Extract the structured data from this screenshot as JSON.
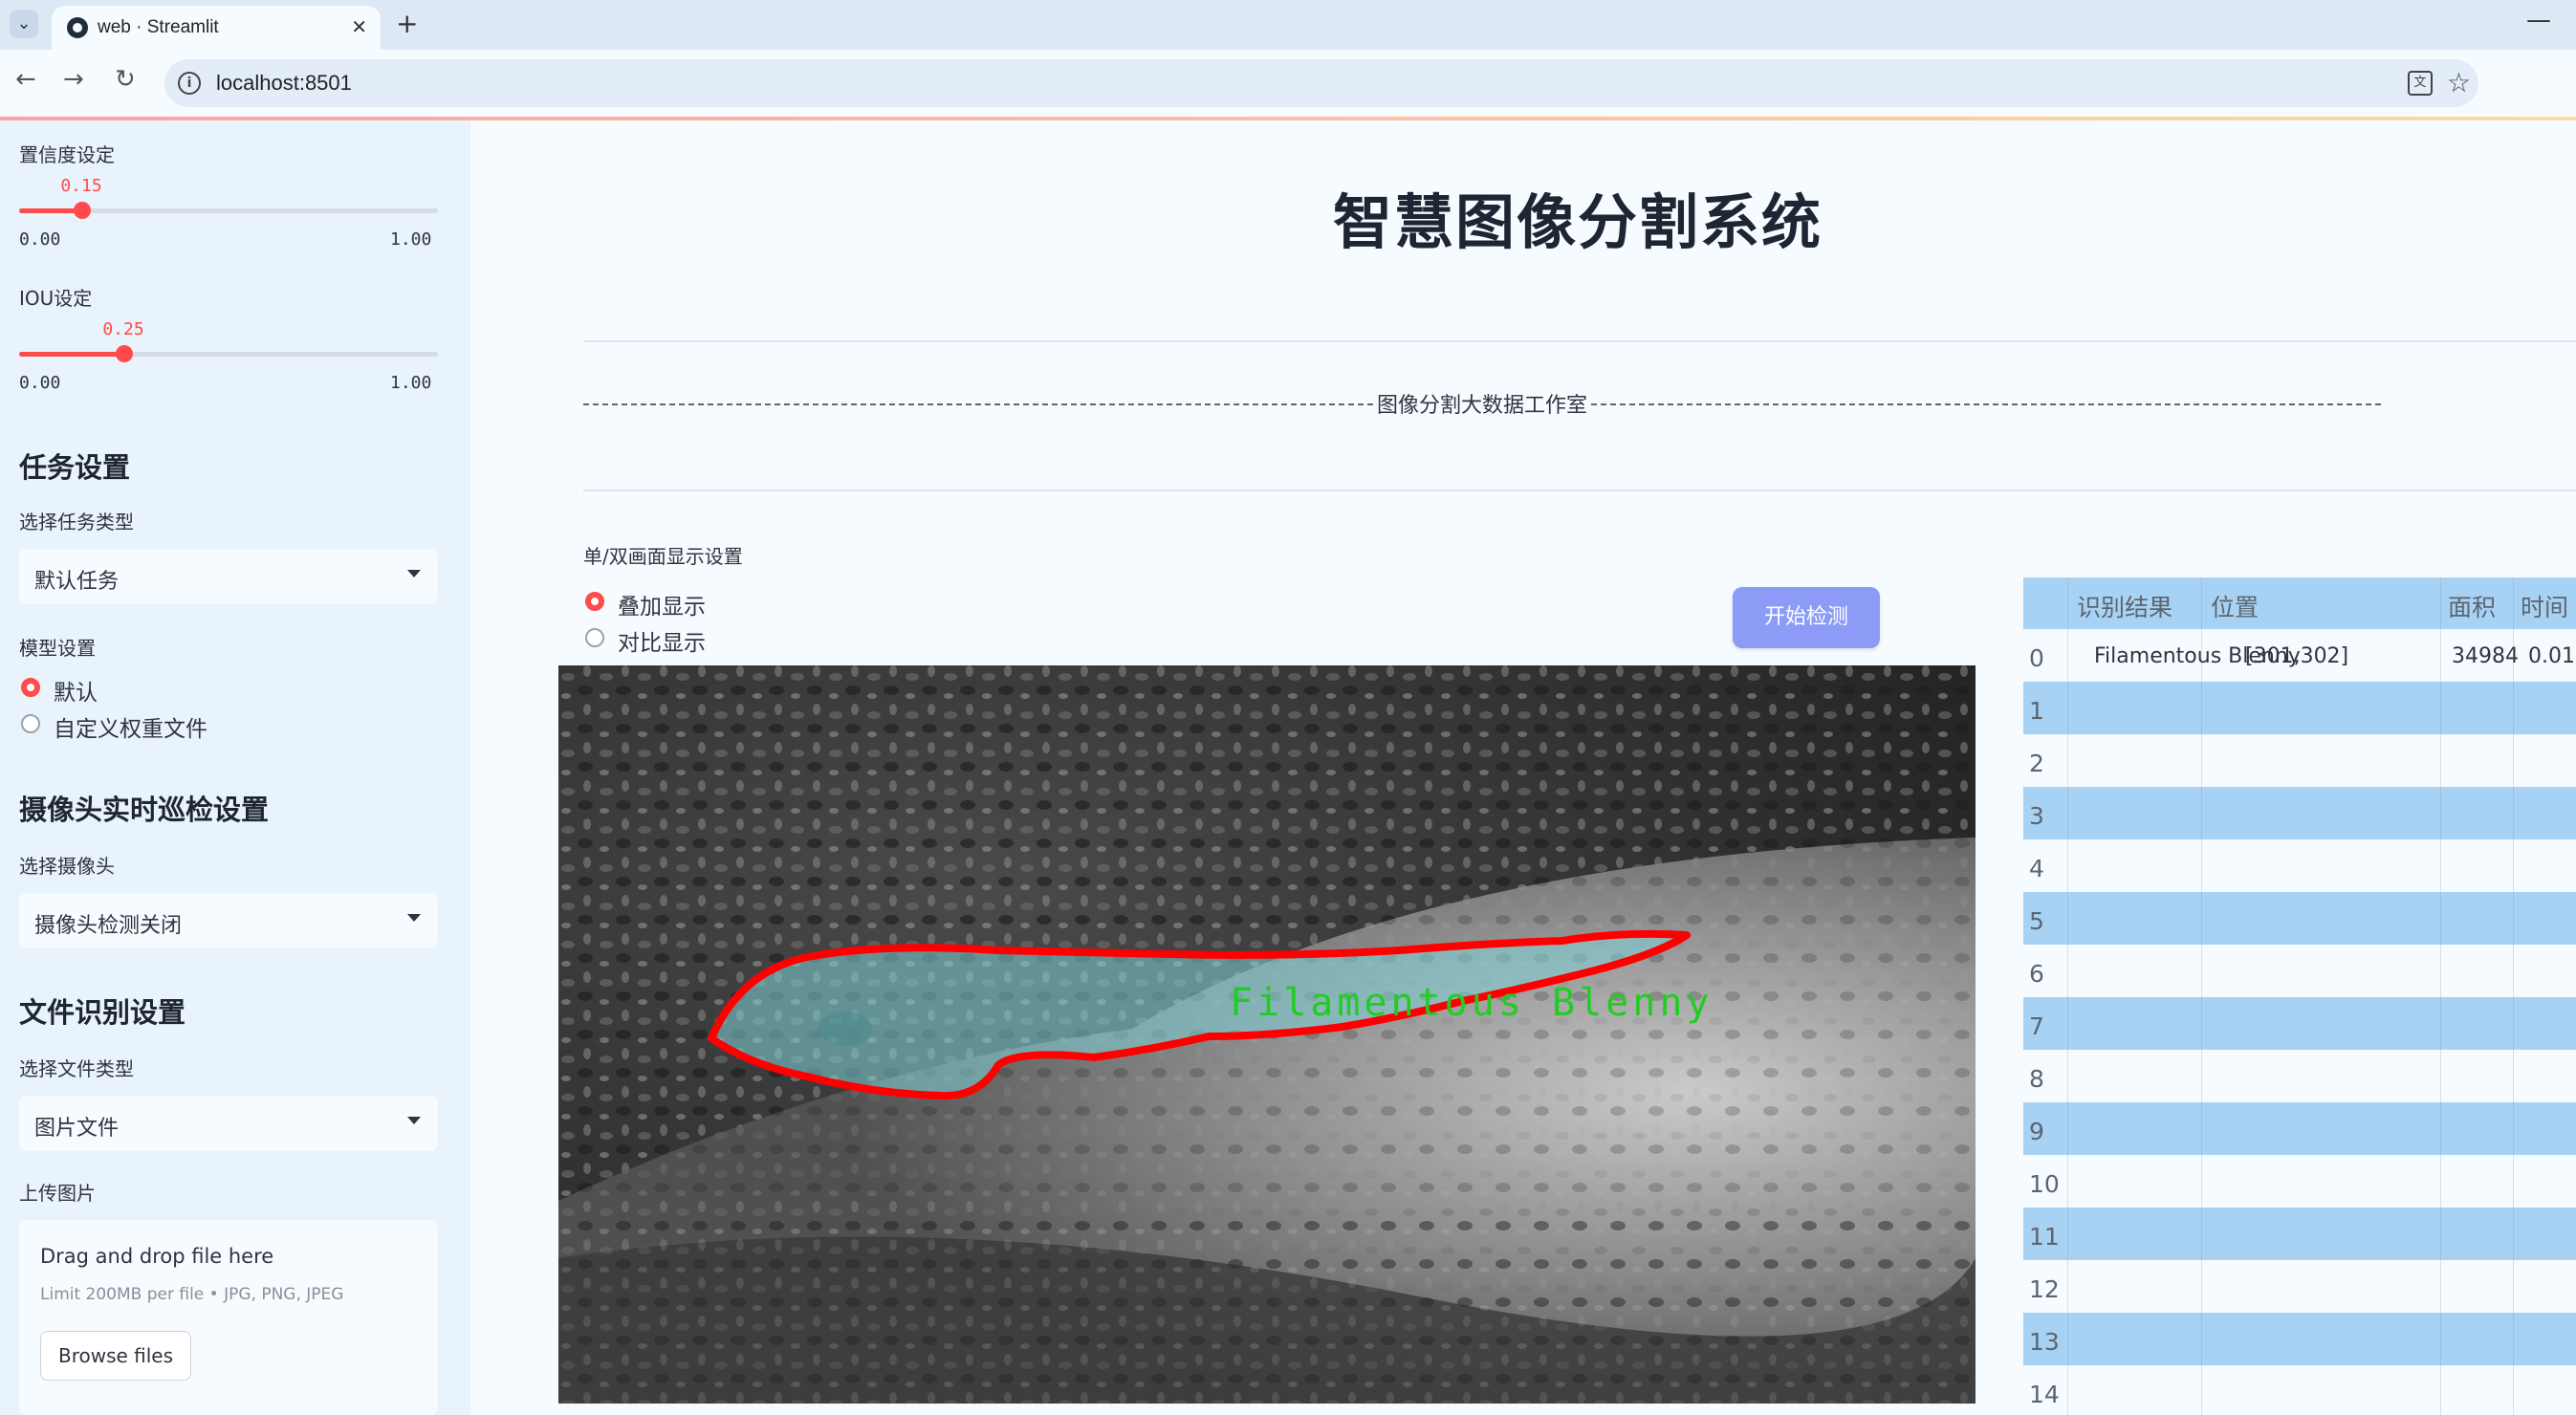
{
  "browser": {
    "tab_title": "web · Streamlit",
    "url": "localhost:8501"
  },
  "sidebar": {
    "confidence": {
      "label": "置信度设定",
      "value": "0.15",
      "value_num": 0.15,
      "min": "0.00",
      "max": "1.00"
    },
    "iou": {
      "label": "IOU设定",
      "value": "0.25",
      "value_num": 0.25,
      "min": "0.00",
      "max": "1.00"
    },
    "task_heading": "任务设置",
    "task_type_label": "选择任务类型",
    "task_type_value": "默认任务",
    "model_label": "模型设置",
    "model_options": [
      "默认",
      "自定义权重文件"
    ],
    "model_selected": 0,
    "camera_heading": "摄像头实时巡检设置",
    "camera_label": "选择摄像头",
    "camera_value": "摄像头检测关闭",
    "file_heading": "文件识别设置",
    "file_type_label": "选择文件类型",
    "file_type_value": "图片文件",
    "upload_label": "上传图片",
    "upload_title": "Drag and drop file here",
    "upload_limit": "Limit 200MB per file • JPG, PNG, JPEG",
    "browse_label": "Browse files"
  },
  "main": {
    "title": "智慧图像分割系统",
    "studio": "图像分割大数据工作室",
    "display_label": "单/双画面显示设置",
    "display_options": [
      "叠加显示",
      "对比显示"
    ],
    "display_selected": 0,
    "start_button": "开始检测",
    "detection_label": "Filamentous Blenny"
  },
  "table": {
    "headers": [
      "识别结果",
      "位置",
      "面积",
      "时间"
    ],
    "row_indices": [
      "0",
      "1",
      "2",
      "3",
      "4",
      "5",
      "6",
      "7",
      "8",
      "9",
      "10",
      "11",
      "12",
      "13",
      "14"
    ],
    "rows": [
      {
        "result": "Filamentous Blenny",
        "position": "[301,302]",
        "area": "34984",
        "time": "0.01"
      }
    ]
  },
  "colors": {
    "accent": "#ff4b4b",
    "button": "#8c9cf6",
    "table_stripe": "#a8d2f4",
    "mask_outline": "#ff0000",
    "mask_fill": "#7fd3d8",
    "label_text": "#22cc22"
  }
}
